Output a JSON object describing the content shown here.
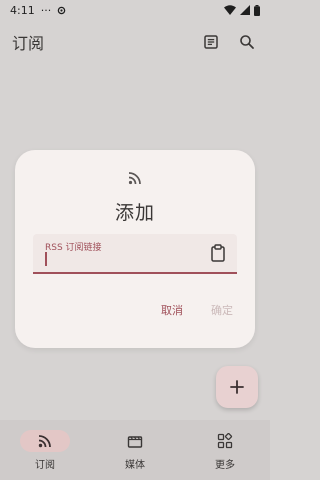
{
  "status_bar": {
    "time": "4:11",
    "dots": "···"
  },
  "app_bar": {
    "title": "订阅",
    "actions": [
      "list-icon",
      "search-icon"
    ]
  },
  "dialog": {
    "icon": "rss-icon",
    "title": "添加",
    "field": {
      "label": "RSS 订阅链接",
      "value": "",
      "trailing_icon": "clipboard-icon"
    },
    "cancel_label": "取消",
    "confirm_label": "确定"
  },
  "fab": {
    "icon": "plus-icon"
  },
  "bottom_nav": {
    "items": [
      {
        "label": "订阅",
        "icon": "rss-icon",
        "active": true
      },
      {
        "label": "媒体",
        "icon": "movie-icon",
        "active": false
      },
      {
        "label": "更多",
        "icon": "grid-shapes-icon",
        "active": false
      }
    ]
  },
  "colors": {
    "scrim_background": "#d6d3d2",
    "dialog_background": "#f6f1ef",
    "accent": "#a0505a",
    "disabled_text": "#cbb9b9",
    "nav_background": "#cfcbca",
    "nav_active_pill": "#e3c7c6",
    "fab_background": "#e8d1d1"
  }
}
